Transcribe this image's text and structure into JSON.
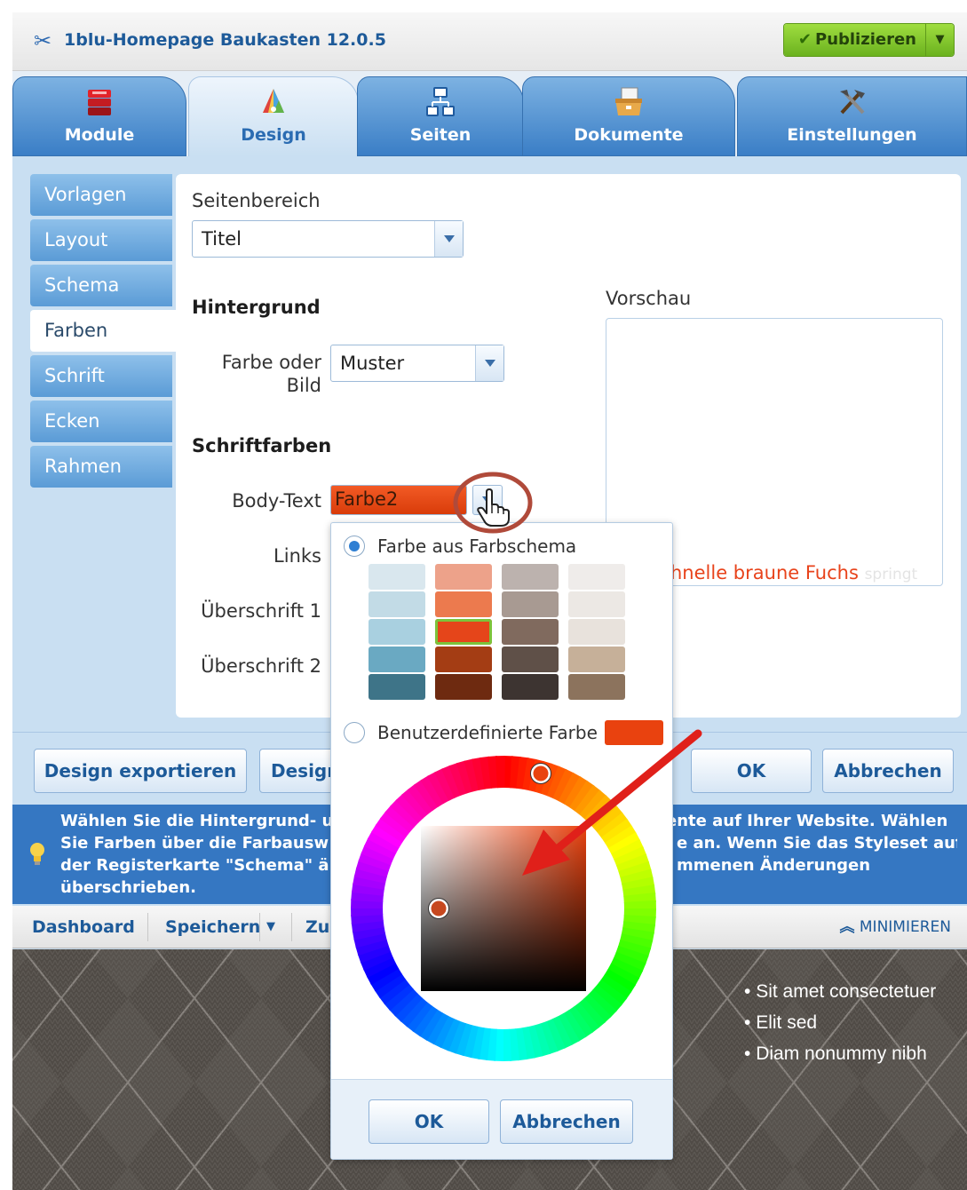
{
  "app": {
    "title": "1blu-Homepage Baukasten 12.0.5",
    "publish_label": "Publizieren"
  },
  "tabs": [
    {
      "label": "Module",
      "icon": "modules-icon"
    },
    {
      "label": "Design",
      "icon": "palette-icon",
      "active": true
    },
    {
      "label": "Seiten",
      "icon": "sitemap-icon"
    },
    {
      "label": "Dokumente",
      "icon": "box-icon"
    },
    {
      "label": "Einstellungen",
      "icon": "tools-icon"
    }
  ],
  "sidenav": [
    "Vorlagen",
    "Layout",
    "Schema",
    "Farben",
    "Schrift",
    "Ecken",
    "Rahmen"
  ],
  "form": {
    "seitenbereich_label": "Seitenbereich",
    "seitenbereich_value": "Titel",
    "hintergrund_heading": "Hintergrund",
    "farbe_oder_label": "Farbe oder",
    "bild_label": "Bild",
    "farbe_oder_value": "Muster",
    "schriftfarben_heading": "Schriftfarben",
    "body_text_label": "Body-Text",
    "body_text_value": "Farbe2",
    "links_label": "Links",
    "ueberschrift1_label": "Überschrift 1",
    "ueberschrift2_label": "Überschrift 2",
    "vorschau_label": "Vorschau",
    "preview_text": "hnelle braune Fuchs",
    "preview_text_fade": "springt"
  },
  "actions": {
    "export": "Design exportieren",
    "design_partial": "Design",
    "ok": "OK",
    "cancel": "Abbrechen"
  },
  "hint": {
    "line1_left": "Wählen Sie die Hintergrund- u",
    "line1_right": "ente auf Ihrer Website. Wählen",
    "line2_left": "Sie Farben über die Farbausw",
    "line2_right": "e an. Wenn Sie das Styleset auf",
    "line3_left": "der Registerkarte \"Schema\" ä",
    "line3_right": "mmenen Änderungen",
    "line4": "überschrieben."
  },
  "statusbar": {
    "dashboard": "Dashboard",
    "speichern": "Speichern",
    "zu_partial": "Zu",
    "minimize": "MINIMIEREN"
  },
  "website": {
    "bullets": [
      "Sit amet consectetuer",
      "Elit sed",
      "Diam nonummy nibh"
    ]
  },
  "picker": {
    "scheme_label": "Farbe aus Farbschema",
    "custom_label": "Benutzerdefinierte Farbe",
    "ok": "OK",
    "cancel": "Abbrechen",
    "custom_color": "#e9420f",
    "swatches": [
      [
        "#d9e7ee",
        "#eda28a",
        "#bcb2ae",
        "#efecea"
      ],
      [
        "#c2dbe6",
        "#ec7a4e",
        "#a89a92",
        "#ece8e4"
      ],
      [
        "#a9d0e0",
        "#e5451a",
        "#806a5e",
        "#e8e2dc"
      ],
      [
        "#6aa9c2",
        "#a43d14",
        "#5f5048",
        "#c6b099"
      ],
      [
        "#3e7488",
        "#6e2a10",
        "#3d3431",
        "#8c735d"
      ]
    ],
    "selected": [
      2,
      1
    ]
  },
  "colors": {
    "accent_blue": "#3577c2",
    "publish_green": "#7bc22c",
    "highlight_red": "#e8431b"
  }
}
